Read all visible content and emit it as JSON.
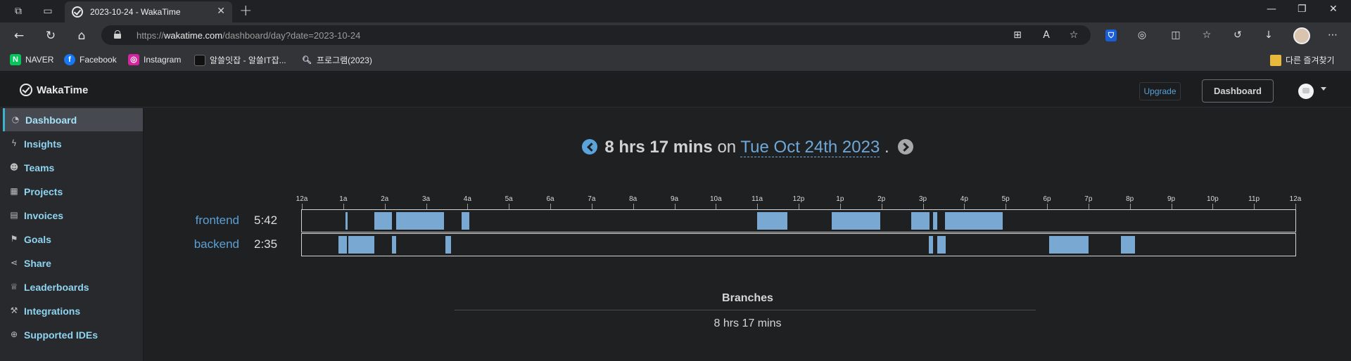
{
  "browser": {
    "tab_title": "2023-10-24 - WakaTime",
    "url_prefix": "https://",
    "url_host": "wakatime.com",
    "url_path": "/dashboard/day?date=2023-10-24",
    "bookmarks": [
      {
        "label": "NAVER",
        "icon": "naver-icon",
        "color": "#03c75a"
      },
      {
        "label": "Facebook",
        "icon": "facebook-icon",
        "color": "#1877f2"
      },
      {
        "label": "Instagram",
        "icon": "instagram-icon",
        "color": "#d6249f"
      },
      {
        "label": "알쓸잇잡 - 알쓸IT잡...",
        "icon": "site-icon",
        "color": "#111111"
      },
      {
        "label": "프로그램(2023)",
        "icon": "search-icon",
        "color": "#333437"
      }
    ],
    "other_bookmarks": "다른 즐겨찾기"
  },
  "header": {
    "app_name": "WakaTime",
    "upgrade_label": "Upgrade",
    "dashboard_label": "Dashboard"
  },
  "sidebar": {
    "items": [
      {
        "label": "Dashboard",
        "icon": "dashboard-gauge-icon",
        "active": true
      },
      {
        "label": "Insights",
        "icon": "bolt-icon"
      },
      {
        "label": "Teams",
        "icon": "users-icon"
      },
      {
        "label": "Projects",
        "icon": "grid-icon"
      },
      {
        "label": "Invoices",
        "icon": "document-icon"
      },
      {
        "label": "Goals",
        "icon": "flag-icon"
      },
      {
        "label": "Share",
        "icon": "share-icon"
      },
      {
        "label": "Leaderboards",
        "icon": "trophy-icon"
      },
      {
        "label": "Integrations",
        "icon": "wrench-icon"
      },
      {
        "label": "Supported IDEs",
        "icon": "plus-circle-icon"
      }
    ]
  },
  "day": {
    "total": "8 hrs 17 mins",
    "on": "on",
    "date": "Tue Oct 24th 2023",
    "period": "."
  },
  "chart_data": {
    "type": "timeline",
    "x_ticks": [
      "12a",
      "1a",
      "2a",
      "3a",
      "4a",
      "5a",
      "6a",
      "7a",
      "8a",
      "9a",
      "10a",
      "11a",
      "12p",
      "1p",
      "2p",
      "3p",
      "4p",
      "5p",
      "6p",
      "7p",
      "8p",
      "9p",
      "10p",
      "11p",
      "12a"
    ],
    "xlim_hours": [
      0,
      24
    ],
    "color": "#79a8d3",
    "series": [
      {
        "name": "frontend",
        "total": "5:42",
        "segments": [
          [
            1.05,
            1.1
          ],
          [
            1.75,
            2.17
          ],
          [
            2.28,
            3.43
          ],
          [
            3.85,
            4.05
          ],
          [
            11.0,
            11.73
          ],
          [
            12.8,
            13.97
          ],
          [
            14.72,
            15.17
          ],
          [
            15.25,
            15.35
          ],
          [
            15.53,
            16.93
          ]
        ]
      },
      {
        "name": "backend",
        "total": "2:35",
        "segments": [
          [
            0.88,
            1.08
          ],
          [
            1.12,
            1.75
          ],
          [
            2.17,
            2.27
          ],
          [
            3.47,
            3.6
          ],
          [
            15.15,
            15.25
          ],
          [
            15.35,
            15.55
          ],
          [
            18.05,
            19.0
          ],
          [
            19.78,
            20.12
          ]
        ]
      }
    ]
  },
  "branches": {
    "title": "Branches",
    "total": "8 hrs 17 mins"
  }
}
